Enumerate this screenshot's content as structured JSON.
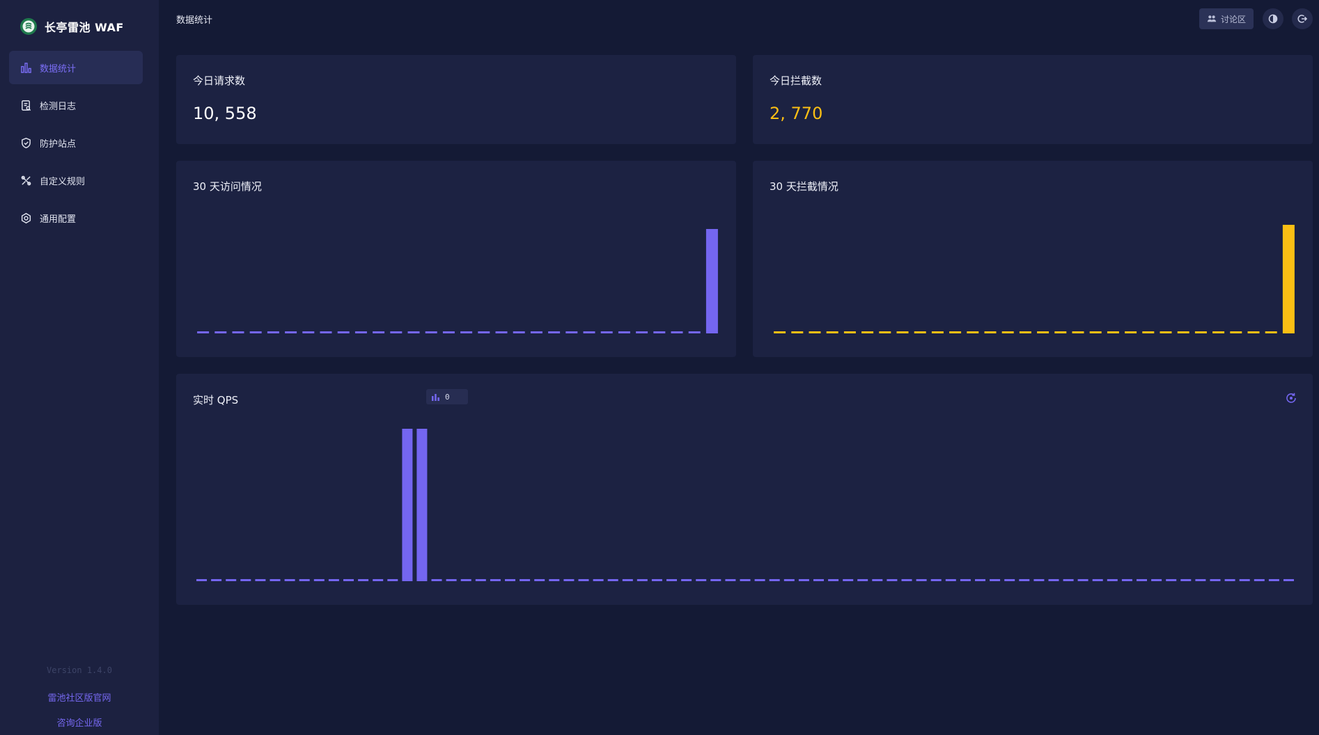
{
  "app": {
    "name": "长亭雷池 WAF"
  },
  "header": {
    "title": "数据统计",
    "forum_label": "讨论区"
  },
  "sidebar": {
    "items": [
      {
        "label": "数据统计",
        "icon": "bar-chart-icon",
        "active": true
      },
      {
        "label": "检测日志",
        "icon": "log-icon"
      },
      {
        "label": "防护站点",
        "icon": "shield-icon"
      },
      {
        "label": "自定义规则",
        "icon": "tools-icon"
      },
      {
        "label": "通用配置",
        "icon": "gear-icon"
      }
    ],
    "version": "Version 1.4.0",
    "community_link": "雷池社区版官网",
    "enterprise_link": "咨询企业版"
  },
  "stats": {
    "requests_label": "今日请求数",
    "requests_value": "10, 558",
    "blocked_label": "今日拦截数",
    "blocked_value": "2, 770"
  },
  "colors": {
    "accent": "#7466f0",
    "warning": "#fbbf14",
    "background": "#141a35",
    "card": "#1c2242",
    "sidebar": "#1c2140"
  },
  "chart_data": [
    {
      "type": "bar",
      "title": "30 天访问情况",
      "color": "#7466f0",
      "values": [
        0,
        0,
        0,
        0,
        0,
        0,
        0,
        0,
        0,
        0,
        0,
        0,
        0,
        0,
        0,
        0,
        0,
        0,
        0,
        0,
        0,
        0,
        0,
        0,
        0,
        0,
        0,
        0,
        0,
        10558
      ]
    },
    {
      "type": "bar",
      "title": "30 天拦截情况",
      "color": "#fbbf14",
      "values": [
        0,
        0,
        0,
        0,
        0,
        0,
        0,
        0,
        0,
        0,
        0,
        0,
        0,
        0,
        0,
        0,
        0,
        0,
        0,
        0,
        0,
        0,
        0,
        0,
        0,
        0,
        0,
        0,
        0,
        2770
      ]
    },
    {
      "type": "bar",
      "title": "实时 QPS",
      "current_value": "0",
      "color": "#7466f0",
      "values": [
        0,
        0,
        0,
        0,
        0,
        0,
        0,
        0,
        0,
        0,
        0,
        0,
        0,
        0,
        1,
        1,
        0,
        0,
        0,
        0,
        0,
        0,
        0,
        0,
        0,
        0,
        0,
        0,
        0,
        0,
        0,
        0,
        0,
        0,
        0,
        0,
        0,
        0,
        0,
        0,
        0,
        0,
        0,
        0,
        0,
        0,
        0,
        0,
        0,
        0,
        0,
        0,
        0,
        0,
        0,
        0,
        0,
        0,
        0,
        0,
        0,
        0,
        0,
        0,
        0,
        0,
        0,
        0,
        0,
        0,
        0,
        0,
        0,
        0,
        0
      ]
    }
  ]
}
